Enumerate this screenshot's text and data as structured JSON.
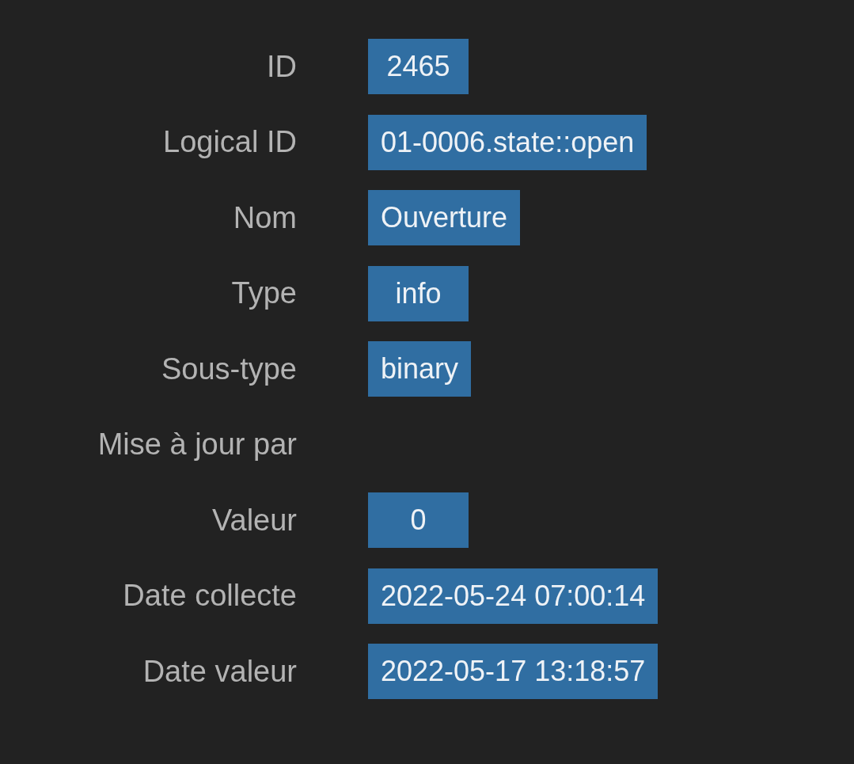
{
  "fields": [
    {
      "label": "ID",
      "value": "2465"
    },
    {
      "label": "Logical ID",
      "value": "01-0006.state::open"
    },
    {
      "label": "Nom",
      "value": "Ouverture"
    },
    {
      "label": "Type",
      "value": "info"
    },
    {
      "label": "Sous-type",
      "value": "binary"
    },
    {
      "label": "Mise à jour par"
    },
    {
      "label": "Valeur",
      "value": "0"
    },
    {
      "label": "Date collecte",
      "value": "2022-05-24 07:00:14"
    },
    {
      "label": "Date valeur",
      "value": "2022-05-17 13:18:57"
    }
  ]
}
